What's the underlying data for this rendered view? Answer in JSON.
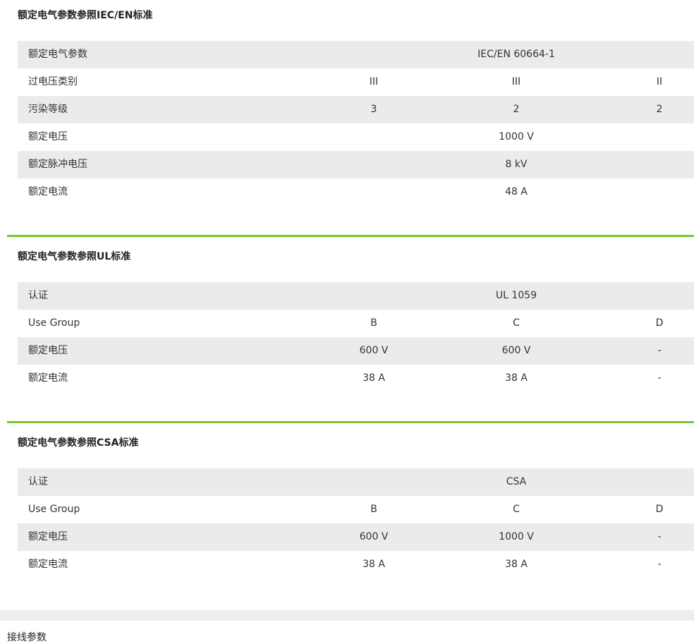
{
  "iec": {
    "title": "额定电气参数参照IEC/EN标准",
    "rows": [
      {
        "label": "额定电气参数",
        "span": "IEC/EN 60664-1"
      },
      {
        "label": "过电压类别",
        "c1": "III",
        "c2": "III",
        "c3": "II"
      },
      {
        "label": "污染等级",
        "c1": "3",
        "c2": "2",
        "c3": "2"
      },
      {
        "label": "额定电压",
        "span": "1000 V"
      },
      {
        "label": "额定脉冲电压",
        "span": "8 kV"
      },
      {
        "label": "额定电流",
        "span": "48 A"
      }
    ]
  },
  "ul": {
    "title": "额定电气参数参照UL标准",
    "rows": [
      {
        "label": "认证",
        "span": "UL 1059"
      },
      {
        "label": "Use Group",
        "c1": "B",
        "c2": "C",
        "c3": "D"
      },
      {
        "label": "额定电压",
        "c1": "600 V",
        "c2": "600 V",
        "c3": "-"
      },
      {
        "label": "额定电流",
        "c1": "38 A",
        "c2": "38 A",
        "c3": "-"
      }
    ]
  },
  "csa": {
    "title": "额定电气参数参照CSA标准",
    "rows": [
      {
        "label": "认证",
        "span": "CSA"
      },
      {
        "label": "Use Group",
        "c1": "B",
        "c2": "C",
        "c3": "D"
      },
      {
        "label": "额定电压",
        "c1": "600 V",
        "c2": "1000 V",
        "c3": "-"
      },
      {
        "label": "额定电流",
        "c1": "38 A",
        "c2": "38 A",
        "c3": "-"
      }
    ]
  },
  "wiring": {
    "title": "接线参数"
  },
  "colors": {
    "accent_rule": "#7ac52b",
    "row_shade": "#ebebeb"
  }
}
